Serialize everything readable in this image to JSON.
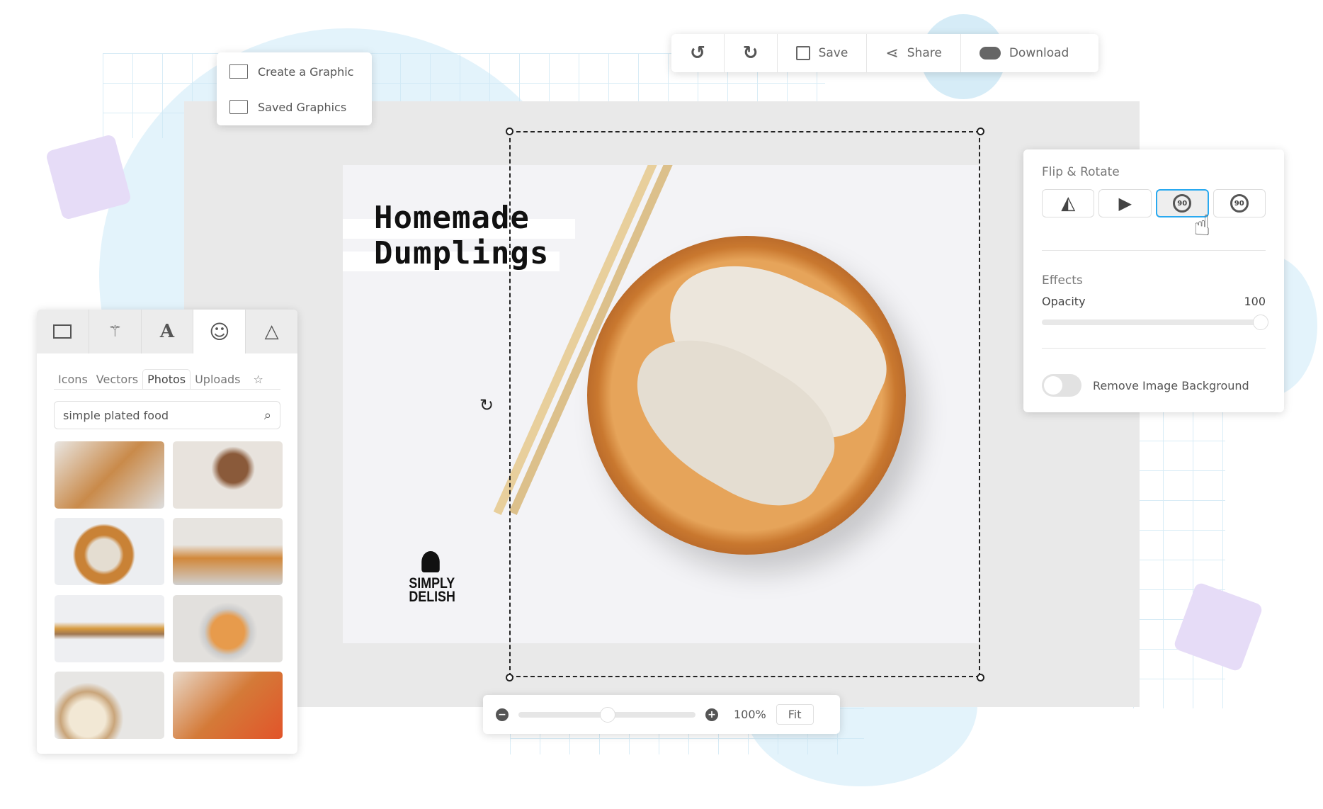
{
  "toolbar": {
    "undo_icon": "undo-icon",
    "redo_icon": "redo-icon",
    "save": "Save",
    "share": "Share",
    "download": "Download"
  },
  "menu": {
    "items": [
      {
        "label": "Create a Graphic",
        "icon": "image-icon"
      },
      {
        "label": "Saved Graphics",
        "icon": "folder-icon"
      }
    ]
  },
  "poster": {
    "title_line1": "Homemade",
    "title_line2": "Dumplings",
    "logo_line1": "SIMPLY",
    "logo_line2": "DELISH"
  },
  "right_panel": {
    "flip_rotate_title": "Flip & Rotate",
    "buttons": [
      "flip-horizontal",
      "flip-vertical",
      "rotate-left-90",
      "rotate-right-90"
    ],
    "rotate_label": "90",
    "effects_title": "Effects",
    "opacity_label": "Opacity",
    "opacity_value": "100",
    "opacity_percent": 100,
    "remove_bg_label": "Remove Image Background",
    "remove_bg_on": false,
    "accent": "#29a9f0"
  },
  "left_panel": {
    "tool_tabs": [
      "image",
      "magic-wand",
      "text",
      "emoji",
      "shape"
    ],
    "active_tool_tab": "emoji",
    "sub_tabs": [
      "Icons",
      "Vectors",
      "Photos",
      "Uploads"
    ],
    "active_sub_tab": "Photos",
    "search_value": "simple plated food"
  },
  "zoom_bar": {
    "value": "100%",
    "fit": "Fit",
    "slider_percent": 50
  }
}
